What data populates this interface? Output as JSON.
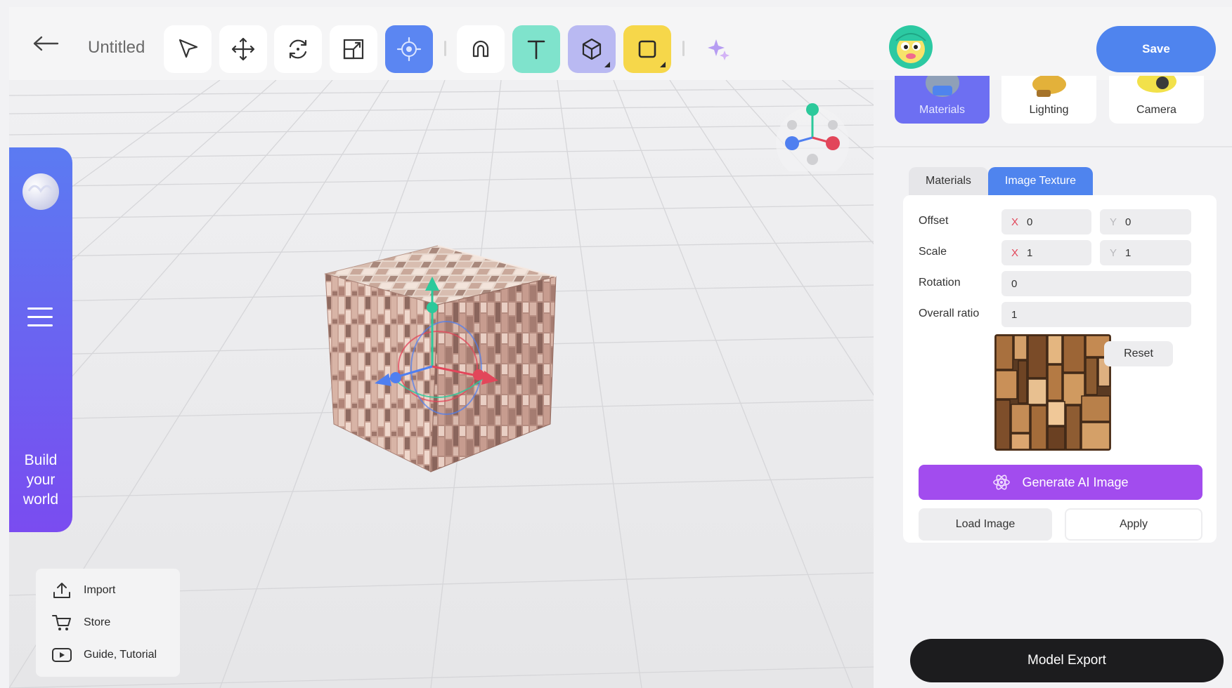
{
  "header": {
    "title": "Untitled",
    "save_label": "Save",
    "tools": [
      {
        "name": "select-tool",
        "icon": "cursor-arrow-icon"
      },
      {
        "name": "move-tool",
        "icon": "move-arrows-icon"
      },
      {
        "name": "rotate-tool",
        "icon": "rotate-icon"
      },
      {
        "name": "scale-tool",
        "icon": "scale-icon"
      },
      {
        "name": "transform-tool",
        "icon": "gizmo-icon",
        "active": true,
        "color": "#5b86f2"
      },
      {
        "name": "magnet-tool",
        "icon": "magnet-icon"
      },
      {
        "name": "text-tool",
        "icon": "text-t-icon",
        "color": "#7fe3cc"
      },
      {
        "name": "shape-3d-tool",
        "icon": "cube-icon",
        "color": "#b9b9f2"
      },
      {
        "name": "shape-2d-tool",
        "icon": "square-icon",
        "color": "#f6d74a"
      },
      {
        "name": "ai-tool",
        "icon": "sparkle-icon"
      }
    ]
  },
  "sidebar": {
    "build_text": [
      "Build",
      "your",
      "world"
    ],
    "gradient": [
      "#5b7bf2",
      "#7a4cf0"
    ]
  },
  "bottom_menu": {
    "items": [
      {
        "label": "Import",
        "icon": "upload-icon"
      },
      {
        "label": "Store",
        "icon": "cart-icon"
      },
      {
        "label": "Guide, Tutorial",
        "icon": "play-icon"
      }
    ]
  },
  "right_panel": {
    "categories": [
      {
        "label": "Materials",
        "active": true
      },
      {
        "label": "Lighting",
        "active": false
      },
      {
        "label": "Camera",
        "active": false
      }
    ],
    "tabs": [
      {
        "label": "Materials",
        "active": false
      },
      {
        "label": "Image Texture",
        "active": true
      }
    ],
    "properties": {
      "offset": {
        "label": "Offset",
        "x_axis": "X",
        "x": "0",
        "y_axis": "Y",
        "y": "0"
      },
      "scale": {
        "label": "Scale",
        "x_axis": "X",
        "x": "1",
        "y_axis": "Y",
        "y": "1"
      },
      "rotation": {
        "label": "Rotation",
        "value": "0"
      },
      "overall_ratio": {
        "label": "Overall ratio",
        "value": "1"
      }
    },
    "reset_label": "Reset",
    "generate_label": "Generate AI Image",
    "load_label": "Load Image",
    "apply_label": "Apply",
    "export_label": "Model Export"
  },
  "colors": {
    "accent_blue": "#4f84ee",
    "ai_purple": "#a24cee",
    "axis_x": "#e2465a",
    "axis_y": "#2cc99b",
    "axis_z": "#4f7ff0",
    "export_black": "#1c1c1e"
  }
}
